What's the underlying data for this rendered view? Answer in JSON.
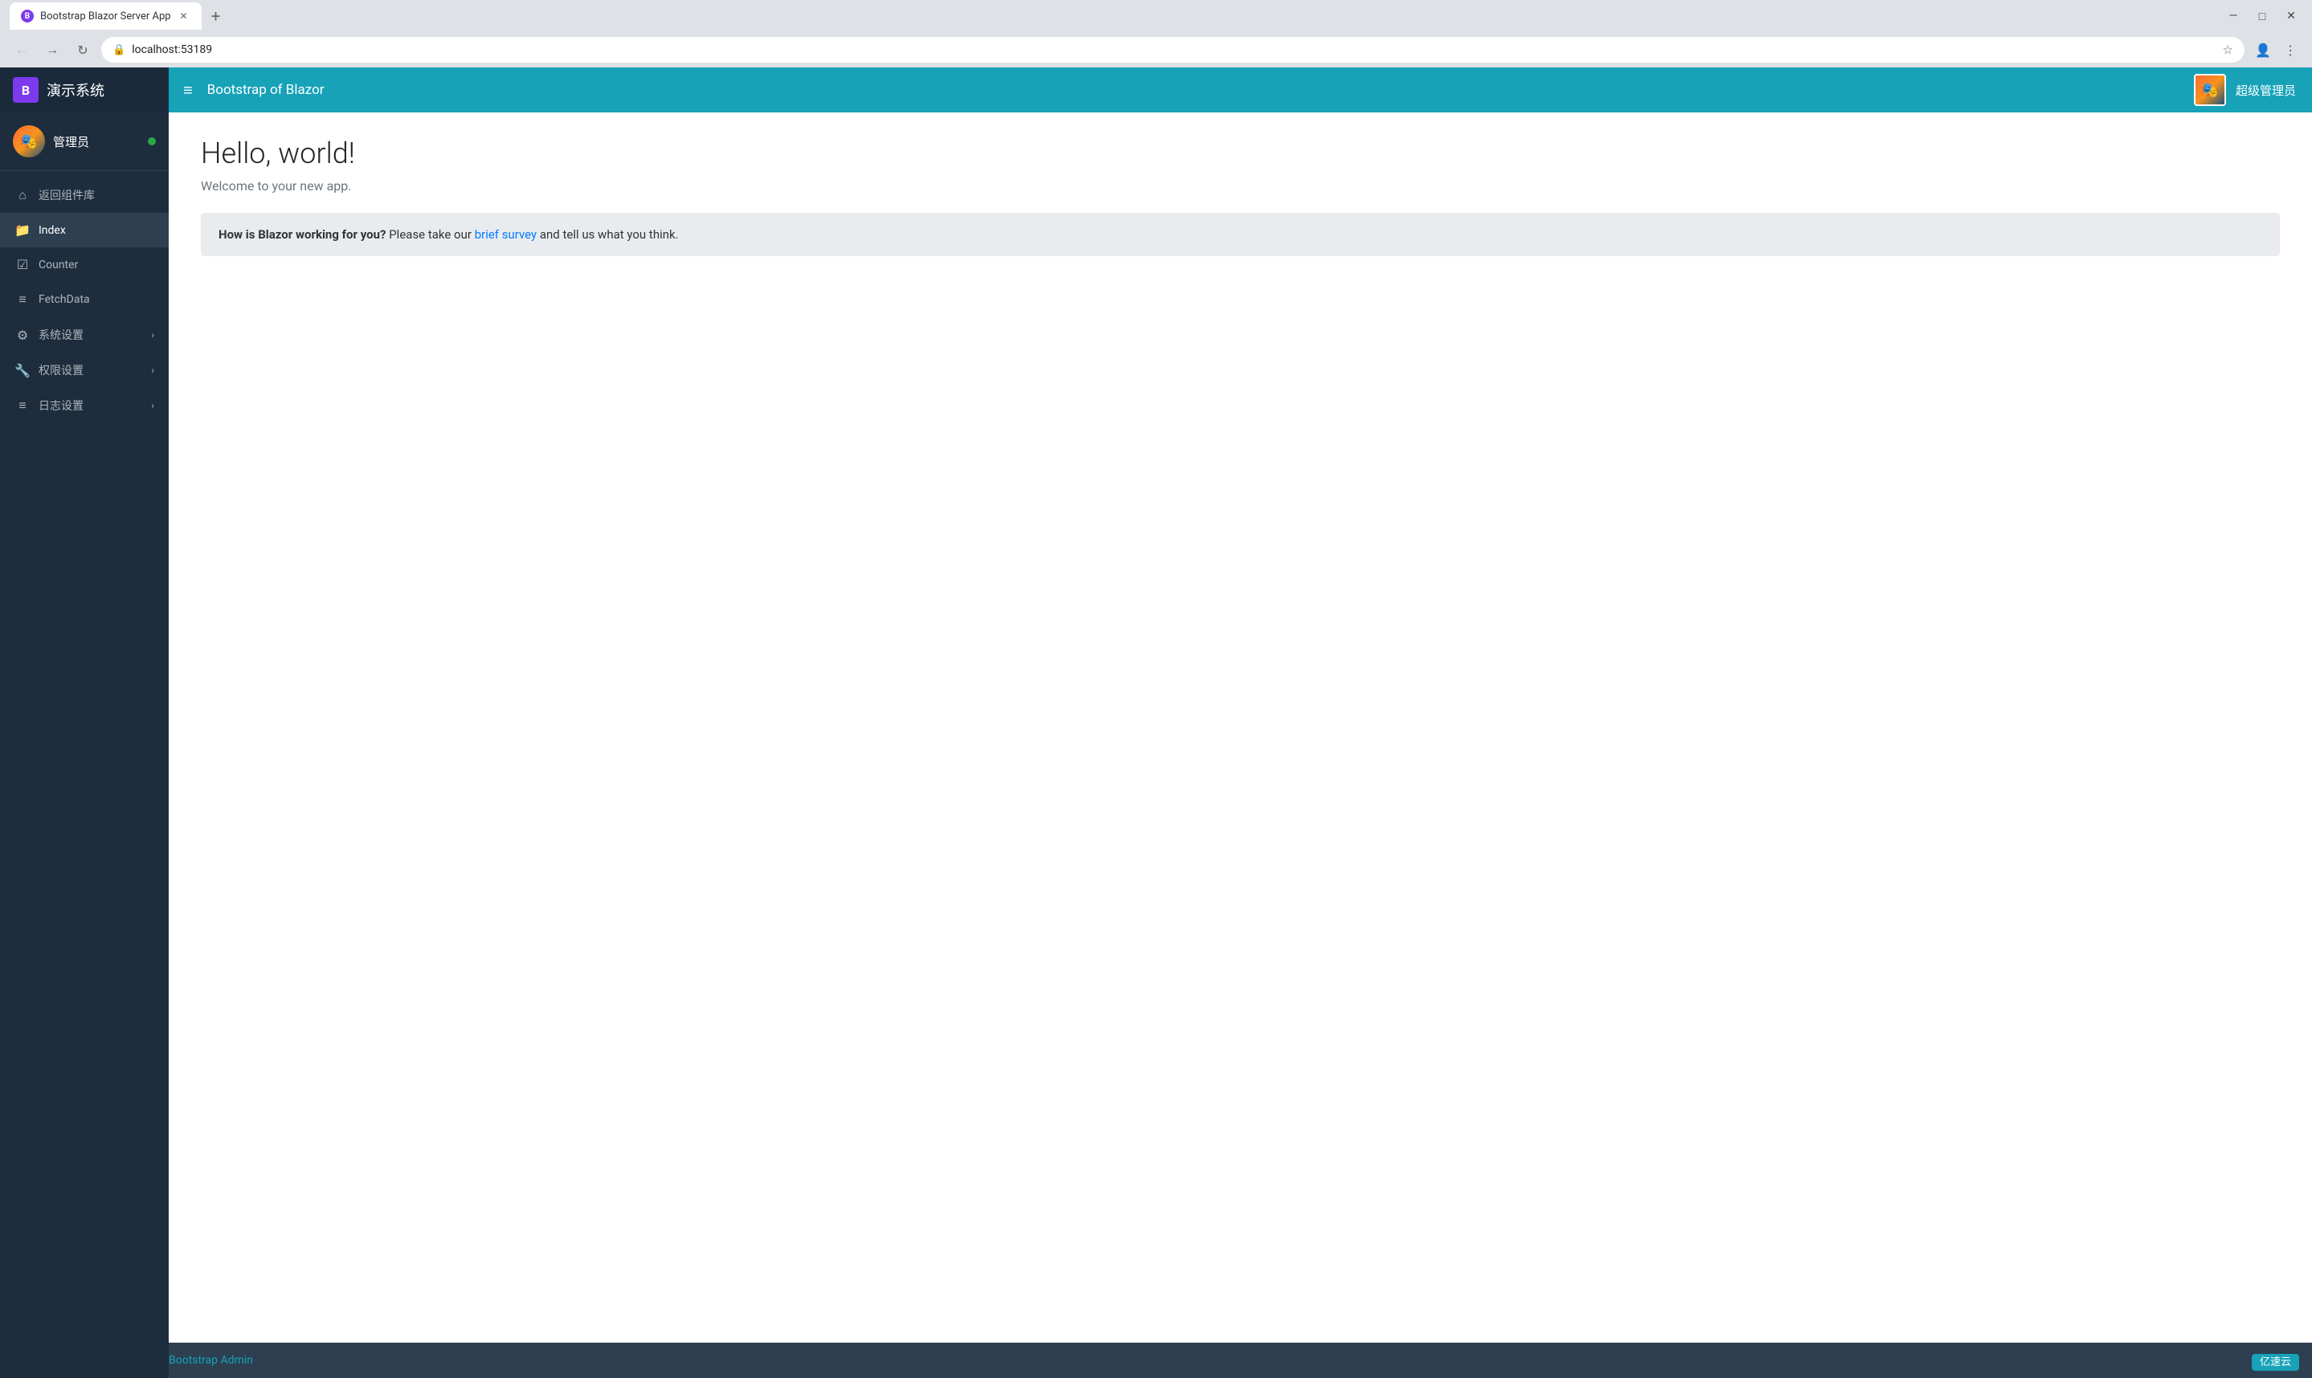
{
  "browser": {
    "tab_title": "Bootstrap Blazor Server App",
    "tab_favicon": "B",
    "url": "localhost:53189",
    "new_tab_label": "+",
    "minimize": "—",
    "maximize": "□",
    "close": "✕"
  },
  "navbar": {
    "brand_logo": "B",
    "brand_name": "演示系统",
    "toggle_icon": "≡",
    "title": "Bootstrap of Blazor",
    "user_name": "超级管理员"
  },
  "sidebar": {
    "username": "管理员",
    "items": [
      {
        "id": "back",
        "label": "返回组件库",
        "icon": "⌂"
      },
      {
        "id": "index",
        "label": "Index",
        "icon": "📁",
        "active": true
      },
      {
        "id": "counter",
        "label": "Counter",
        "icon": "☑"
      },
      {
        "id": "fetchdata",
        "label": "FetchData",
        "icon": "≡"
      },
      {
        "id": "system-settings",
        "label": "系统设置",
        "icon": "⚙",
        "has_arrow": true
      },
      {
        "id": "permission-settings",
        "label": "权限设置",
        "icon": "🔧",
        "has_arrow": true
      },
      {
        "id": "log-settings",
        "label": "日志设置",
        "icon": "≡",
        "has_arrow": true
      }
    ]
  },
  "main": {
    "page_title": "Hello, world!",
    "page_subtitle": "Welcome to your new app.",
    "survey_bold": "How is Blazor working for you?",
    "survey_text": " Please take our ",
    "survey_link_text": "brief survey",
    "survey_end": " and tell us what you think."
  },
  "footer": {
    "link_text": "Bootstrap Admin",
    "badge_text": "亿速云"
  }
}
